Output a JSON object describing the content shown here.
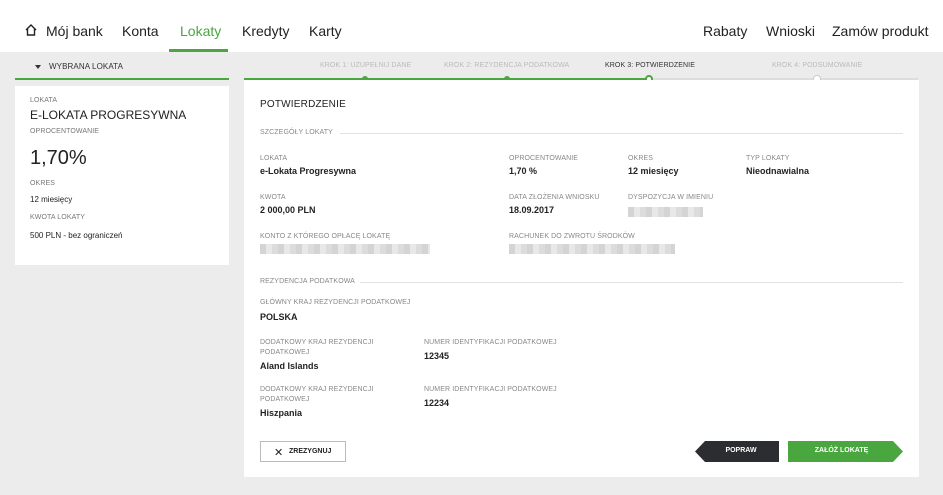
{
  "nav": {
    "home": "Mój bank",
    "accounts": "Konta",
    "deposits": "Lokaty",
    "credits": "Kredyty",
    "cards": "Karty",
    "discounts": "Rabaty",
    "applications": "Wnioski",
    "order": "Zamów produkt"
  },
  "left": {
    "header": "WYBRANA LOKATA",
    "deposit_label": "LOKATA",
    "deposit_name": "E-LOKATA PROGRESYWNA",
    "rate_label": "OPROCENTOWANIE",
    "rate": "1,70%",
    "period_label": "OKRES",
    "period": "12 miesięcy",
    "amount_label": "KWOTA LOKATY",
    "amount": "500 PLN - bez ograniczeń"
  },
  "steps": [
    {
      "label": "KROK 1: UZUPEŁNIJ DANE",
      "state": "done"
    },
    {
      "label": "KROK 2: REZYDENCJA PODATKOWA",
      "state": "done"
    },
    {
      "label": "KROK 3: POTWIERDZENIE",
      "state": "current"
    },
    {
      "label": "KROK 4: PODSUMOWANIE",
      "state": "future"
    }
  ],
  "main": {
    "title": "POTWIERDZENIE",
    "details_section": "SZCZEGÓŁY LOKATY",
    "deposit_label": "LOKATA",
    "deposit_value": "e-Lokata Progresywna",
    "rate_label": "OPROCENTOWANIE",
    "rate_value": "1,70 %",
    "period_label": "OKRES",
    "period_value": "12 miesięcy",
    "type_label": "TYP LOKATY",
    "type_value": "Nieodnawialna",
    "amount_label": "KWOTA",
    "amount_value": "2 000,00 PLN",
    "date_label": "DATA ZŁOŻENIA WNIOSKU",
    "date_value": "18.09.2017",
    "disposition_label": "DYSPOZYCJA W IMIENIU",
    "source_account_label": "KONTO Z KTÓREGO OPŁACĘ LOKATĘ",
    "return_account_label": "RACHUNEK DO ZWROTU ŚRODKÓW",
    "tax_section": "REZYDENCJA PODATKOWA",
    "main_country_label": "GŁÓWNY KRAJ REZYDENCJI PODATKOWEJ",
    "main_country_value": "POLSKA",
    "extra": [
      {
        "country_label": "DODATKOWY KRAJ REZYDENCJI PODATKOWEJ",
        "country_value": "Aland Islands",
        "tin_label": "NUMER IDENTYFIKACJI PODATKOWEJ",
        "tin_value": "12345"
      },
      {
        "country_label": "DODATKOWY KRAJ REZYDENCJI PODATKOWEJ",
        "country_value": "Hiszpania",
        "tin_label": "NUMER IDENTYFIKACJI PODATKOWEJ",
        "tin_value": "12234"
      }
    ],
    "cancel": "ZREZYGNUJ",
    "back": "POPRAW",
    "submit": "ZAŁÓŻ LOKATĘ"
  },
  "colors": {
    "accent": "#4aa63e",
    "dark_button": "#2b2d31",
    "background": "#ececec"
  }
}
